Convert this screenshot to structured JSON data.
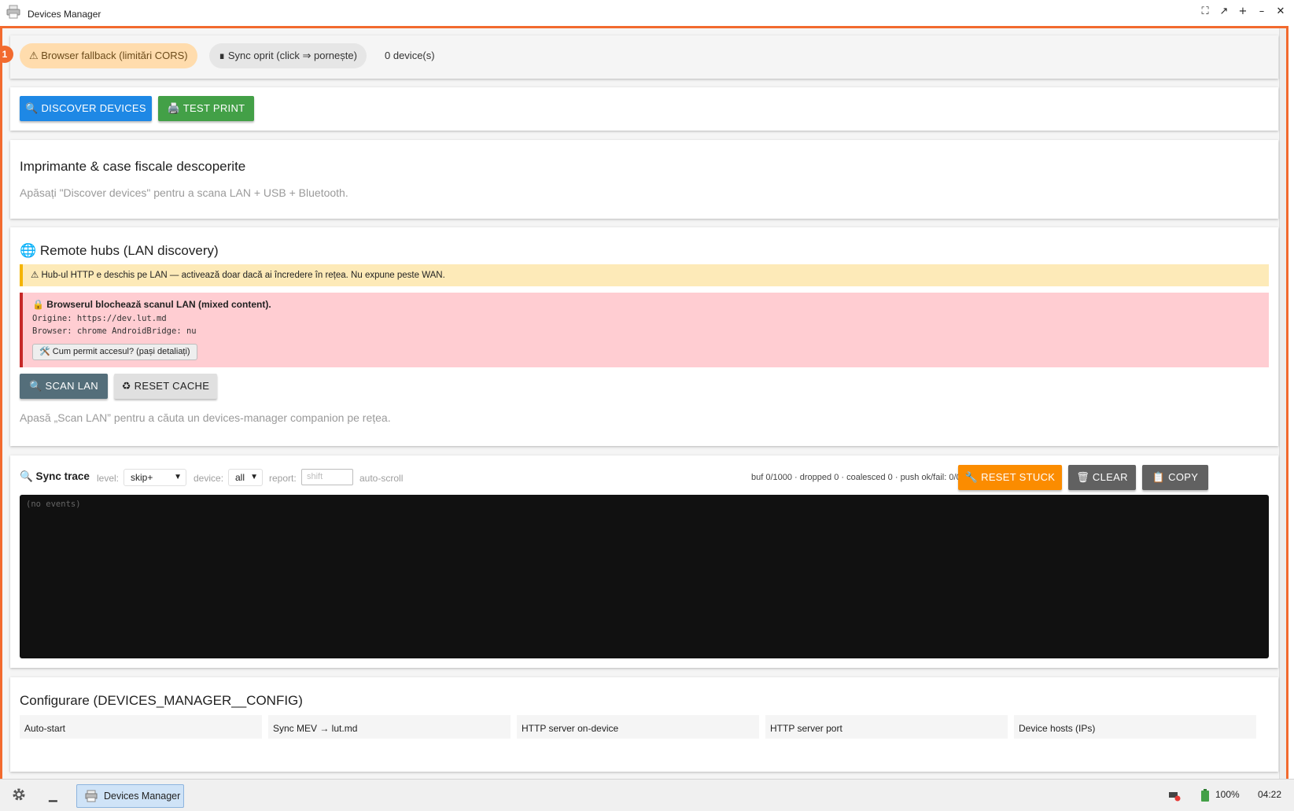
{
  "window": {
    "title": "Devices Manager",
    "controls": [
      "fullscreen-icon",
      "restore-icon",
      "plus-icon",
      "minimize-icon",
      "close-icon"
    ],
    "badge": "1"
  },
  "status": {
    "mode_pill": "⚠ Browser fallback (limitări CORS)",
    "sync_pill": "∎ Sync oprit (click ⇒ pornește)",
    "device_count": "0 device(s)"
  },
  "actions": {
    "discover_label": "🔍 DISCOVER DEVICES",
    "test_print_label": "🖨️ TEST PRINT"
  },
  "discovered": {
    "title": "Imprimante & case fiscale descoperite",
    "hint": "Apăsați \"Discover devices\" pentru a scana LAN + USB + Bluetooth."
  },
  "hubs": {
    "title": "🌐 Remote hubs (LAN discovery)",
    "warning": "⚠ Hub-ul HTTP e deschis pe LAN — activează doar dacă ai încredere în rețea. Nu expune peste WAN.",
    "error_title": "🔒 Browserul blochează scanul LAN (mixed content).",
    "origin_line": "Origine: https://dev.lut.md",
    "browser_line": "Browser: chrome AndroidBridge: nu",
    "how_button": "🛠️ Cum permit accesul? (pași detaliați)",
    "scan_label": "🔍 SCAN LAN",
    "reset_cache_label": "♻ RESET CACHE",
    "scan_hint": "Apasă „Scan LAN” pentru a căuta un devices-manager companion pe rețea."
  },
  "trace": {
    "title": "🔍 Sync trace",
    "level_label": "level:",
    "level_value": "skip+",
    "device_label": "device:",
    "device_value": "all",
    "report_label": "report:",
    "report_placeholder": "shift",
    "autoscroll_label": "auto-scroll",
    "stats": "buf 0/1000 · dropped 0 · coalesced 0 · push ok/fail: 0/0",
    "reset_stuck_label": "🔧 RESET STUCK",
    "clear_label": "🗑 CLEAR",
    "copy_label": "📋 COPY",
    "console_text": "(no events)"
  },
  "config": {
    "title": "Configurare (DEVICES_MANAGER__CONFIG)",
    "fields": [
      "Auto-start",
      "Sync MEV → lut.md",
      "HTTP server on-device",
      "HTTP server port",
      "Device hosts (IPs)"
    ]
  },
  "taskbar": {
    "app_label": "Devices Manager",
    "battery": "100%",
    "clock": "04:22"
  }
}
